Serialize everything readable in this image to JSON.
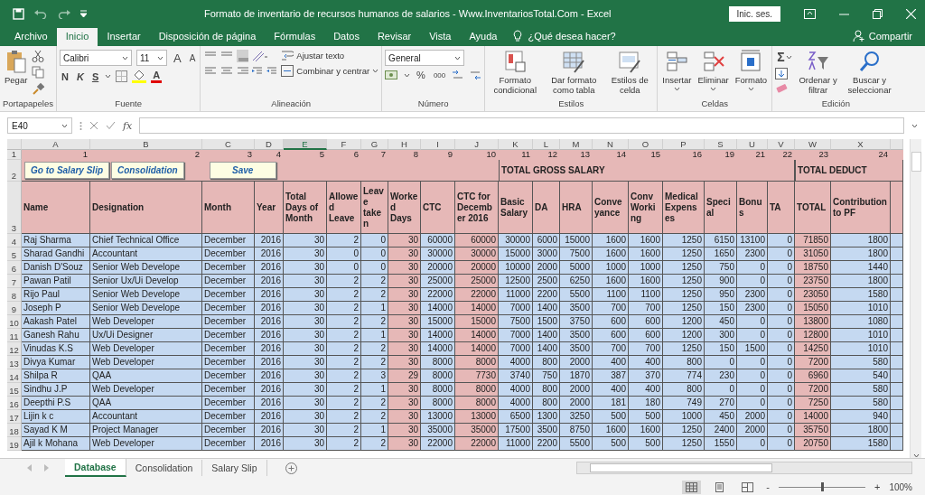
{
  "window": {
    "title": "Formato de inventario de recursos humanos de salarios - Www.InventariosTotal.Com  -  Excel",
    "sign_in": "Inic. ses."
  },
  "tabs": [
    {
      "label": "Archivo",
      "selected": false
    },
    {
      "label": "Inicio",
      "selected": true
    },
    {
      "label": "Insertar",
      "selected": false
    },
    {
      "label": "Disposición de página",
      "selected": false
    },
    {
      "label": "Fórmulas",
      "selected": false
    },
    {
      "label": "Datos",
      "selected": false
    },
    {
      "label": "Revisar",
      "selected": false
    },
    {
      "label": "Vista",
      "selected": false
    },
    {
      "label": "Ayuda",
      "selected": false
    }
  ],
  "tell_me": "¿Qué desea hacer?",
  "share": "Compartir",
  "ribbon": {
    "clipboard": {
      "label": "Portapapeles",
      "paste": "Pegar"
    },
    "font": {
      "label": "Fuente",
      "family": "Calibri",
      "size": "11",
      "grow": "A",
      "shrink": "A",
      "bold": "N",
      "italic": "K",
      "underline": "S",
      "font_color": "A"
    },
    "alignment": {
      "label": "Alineación",
      "wrap": "Ajustar texto",
      "merge": "Combinar y centrar"
    },
    "number": {
      "label": "Número",
      "format": "General",
      "percent": "%",
      "thousands": "000"
    },
    "styles": {
      "label": "Estilos",
      "buttons": [
        "Formato condicional",
        "Dar formato como tabla",
        "Estilos de celda"
      ]
    },
    "cells": {
      "label": "Celdas",
      "buttons": [
        "Insertar",
        "Eliminar",
        "Formato"
      ]
    },
    "editing": {
      "label": "Edición",
      "sum": "Σ",
      "buttons": [
        "Ordenar y filtrar",
        "Buscar y seleccionar"
      ]
    }
  },
  "formula_bar": {
    "name_box": "E40",
    "fx": "fx"
  },
  "row_numbers": [
    "1",
    "2",
    "3"
  ],
  "columns": [
    {
      "letter": "A",
      "number": "1",
      "header": "Name",
      "kind": "text",
      "highlight": false,
      "selected": false
    },
    {
      "letter": "B",
      "number": "2",
      "header": "Designation",
      "kind": "text",
      "highlight": false,
      "selected": false
    },
    {
      "letter": "C",
      "number": "3",
      "header": "Month",
      "kind": "text",
      "highlight": false,
      "selected": false
    },
    {
      "letter": "D",
      "number": "4",
      "header": "Year",
      "kind": "number",
      "highlight": false,
      "selected": false
    },
    {
      "letter": "E",
      "number": "5",
      "header": "Total Days of Month",
      "kind": "number",
      "highlight": false,
      "selected": true
    },
    {
      "letter": "F",
      "number": "6",
      "header": "Allowed Leave",
      "kind": "number",
      "highlight": false,
      "selected": false
    },
    {
      "letter": "G",
      "number": "7",
      "header": "Leave taken",
      "kind": "number",
      "highlight": false,
      "selected": false
    },
    {
      "letter": "H",
      "number": "8",
      "header": "Worked Days",
      "kind": "number",
      "highlight": true,
      "selected": false
    },
    {
      "letter": "I",
      "number": "9",
      "header": "CTC",
      "kind": "number",
      "highlight": false,
      "selected": false
    },
    {
      "letter": "J",
      "number": "10",
      "header": "CTC for December 2016",
      "kind": "number",
      "highlight": true,
      "selected": false
    },
    {
      "letter": "K",
      "number": "11",
      "header": "Basic Salary",
      "kind": "number",
      "highlight": false,
      "selected": false
    },
    {
      "letter": "L",
      "number": "12",
      "header": "DA",
      "kind": "number",
      "highlight": false,
      "selected": false
    },
    {
      "letter": "M",
      "number": "13",
      "header": "HRA",
      "kind": "number",
      "highlight": false,
      "selected": false
    },
    {
      "letter": "N",
      "number": "14",
      "header": "Conveyance",
      "kind": "number",
      "highlight": false,
      "selected": false
    },
    {
      "letter": "O",
      "number": "15",
      "header": "Conv Working",
      "kind": "number",
      "highlight": false,
      "selected": false
    },
    {
      "letter": "P",
      "number": "16",
      "header": "Medical Expenses",
      "kind": "number",
      "highlight": false,
      "selected": false
    },
    {
      "letter": "S",
      "number": "19",
      "header": "Special",
      "kind": "number",
      "highlight": false,
      "selected": false
    },
    {
      "letter": "U",
      "number": "21",
      "header": "Bonus",
      "kind": "number",
      "highlight": false,
      "selected": false
    },
    {
      "letter": "V",
      "number": "22",
      "header": "TA",
      "kind": "number",
      "highlight": false,
      "selected": false
    },
    {
      "letter": "W",
      "number": "23",
      "header": "TOTAL",
      "kind": "number",
      "highlight": true,
      "selected": false
    },
    {
      "letter": "X",
      "number": "24",
      "header": "Contribution to PF",
      "kind": "number",
      "highlight": false,
      "selected": false
    }
  ],
  "row_2": [
    {
      "kind": "button",
      "label": "Go to Salary Slip"
    },
    {
      "kind": "button",
      "label": "Consolidation"
    },
    {
      "kind": "button",
      "label": "Save"
    },
    {
      "kind": "section",
      "label": "TOTAL GROSS SALARY"
    },
    {
      "kind": "section",
      "label": "TOTAL DEDUCT"
    }
  ],
  "rows": [
    {
      "number": "4",
      "cells": [
        "Raj Sharma",
        "Chief Technical Office",
        "December",
        "2016",
        "30",
        "2",
        "0",
        "30",
        "60000",
        "60000",
        "30000",
        "6000",
        "15000",
        "1600",
        "1600",
        "1250",
        "6150",
        "13100",
        "0",
        "71850",
        "1800"
      ]
    },
    {
      "number": "5",
      "cells": [
        "Sharad Gandhi",
        "Accountant",
        "December",
        "2016",
        "30",
        "0",
        "0",
        "30",
        "30000",
        "30000",
        "15000",
        "3000",
        "7500",
        "1600",
        "1600",
        "1250",
        "1650",
        "2300",
        "0",
        "31050",
        "1800"
      ]
    },
    {
      "number": "6",
      "cells": [
        "Danish D'Souz",
        "Senior Web Develope",
        "December",
        "2016",
        "30",
        "0",
        "0",
        "30",
        "20000",
        "20000",
        "10000",
        "2000",
        "5000",
        "1000",
        "1000",
        "1250",
        "750",
        "0",
        "0",
        "18750",
        "1440"
      ]
    },
    {
      "number": "7",
      "cells": [
        "Pawan Patil",
        "Senior Ux/Ui Develop",
        "December",
        "2016",
        "30",
        "2",
        "2",
        "30",
        "25000",
        "25000",
        "12500",
        "2500",
        "6250",
        "1600",
        "1600",
        "1250",
        "900",
        "0",
        "0",
        "23750",
        "1800"
      ]
    },
    {
      "number": "8",
      "cells": [
        "Rijo Paul",
        "Senior Web Develope",
        "December",
        "2016",
        "30",
        "2",
        "2",
        "30",
        "22000",
        "22000",
        "11000",
        "2200",
        "5500",
        "1100",
        "1100",
        "1250",
        "950",
        "2300",
        "0",
        "23050",
        "1580"
      ]
    },
    {
      "number": "9",
      "cells": [
        "Joseph P",
        "Senior Web Develope",
        "December",
        "2016",
        "30",
        "2",
        "1",
        "30",
        "14000",
        "14000",
        "7000",
        "1400",
        "3500",
        "700",
        "700",
        "1250",
        "150",
        "2300",
        "0",
        "15050",
        "1010"
      ]
    },
    {
      "number": "10",
      "cells": [
        "Aakash Patel",
        "Web Developer",
        "December",
        "2016",
        "30",
        "2",
        "2",
        "30",
        "15000",
        "15000",
        "7500",
        "1500",
        "3750",
        "600",
        "600",
        "1200",
        "450",
        "0",
        "0",
        "13800",
        "1080"
      ]
    },
    {
      "number": "11",
      "cells": [
        "Ganesh Rahu",
        "Ux/Ui Designer",
        "December",
        "2016",
        "30",
        "2",
        "1",
        "30",
        "14000",
        "14000",
        "7000",
        "1400",
        "3500",
        "600",
        "600",
        "1200",
        "300",
        "0",
        "0",
        "12800",
        "1010"
      ]
    },
    {
      "number": "12",
      "cells": [
        "Vinudas K.S",
        "Web Developer",
        "December",
        "2016",
        "30",
        "2",
        "2",
        "30",
        "14000",
        "14000",
        "7000",
        "1400",
        "3500",
        "700",
        "700",
        "1250",
        "150",
        "1500",
        "0",
        "14250",
        "1010"
      ]
    },
    {
      "number": "13",
      "cells": [
        "Divya Kumar",
        "Web Developer",
        "December",
        "2016",
        "30",
        "2",
        "2",
        "30",
        "8000",
        "8000",
        "4000",
        "800",
        "2000",
        "400",
        "400",
        "800",
        "0",
        "0",
        "0",
        "7200",
        "580"
      ]
    },
    {
      "number": "14",
      "cells": [
        "Shilpa R",
        "QAA",
        "December",
        "2016",
        "30",
        "2",
        "3",
        "29",
        "8000",
        "7730",
        "3740",
        "750",
        "1870",
        "387",
        "370",
        "774",
        "230",
        "0",
        "0",
        "6960",
        "540"
      ]
    },
    {
      "number": "15",
      "cells": [
        "Sindhu J.P",
        "Web Developer",
        "December",
        "2016",
        "30",
        "2",
        "1",
        "30",
        "8000",
        "8000",
        "4000",
        "800",
        "2000",
        "400",
        "400",
        "800",
        "0",
        "0",
        "0",
        "7200",
        "580"
      ]
    },
    {
      "number": "16",
      "cells": [
        "Deepthi P.S",
        "QAA",
        "December",
        "2016",
        "30",
        "2",
        "2",
        "30",
        "8000",
        "8000",
        "4000",
        "800",
        "2000",
        "181",
        "180",
        "749",
        "270",
        "0",
        "0",
        "7250",
        "580"
      ]
    },
    {
      "number": "17",
      "cells": [
        "Lijin k c",
        "Accountant",
        "December",
        "2016",
        "30",
        "2",
        "2",
        "30",
        "13000",
        "13000",
        "6500",
        "1300",
        "3250",
        "500",
        "500",
        "1000",
        "450",
        "2000",
        "0",
        "14000",
        "940"
      ]
    },
    {
      "number": "18",
      "cells": [
        "Sayad K M",
        "Project Manager",
        "December",
        "2016",
        "30",
        "2",
        "1",
        "30",
        "35000",
        "35000",
        "17500",
        "3500",
        "8750",
        "1600",
        "1600",
        "1250",
        "2400",
        "2000",
        "0",
        "35750",
        "1800"
      ]
    },
    {
      "number": "19",
      "cells": [
        "Ajil k Mohana",
        "Web Developer",
        "December",
        "2016",
        "30",
        "2",
        "2",
        "30",
        "22000",
        "22000",
        "11000",
        "2200",
        "5500",
        "500",
        "500",
        "1250",
        "1550",
        "0",
        "0",
        "20750",
        "1580"
      ]
    }
  ],
  "sheets": [
    {
      "label": "Database",
      "selected": true
    },
    {
      "label": "Consolidation",
      "selected": false
    },
    {
      "label": "Salary Slip",
      "selected": false
    }
  ],
  "status_bar": {
    "views": [
      {
        "selected": true
      },
      {
        "selected": false
      },
      {
        "selected": false
      }
    ],
    "zoom_out": "-",
    "zoom_in": "+",
    "zoom": {
      "level": 0.5,
      "reading": "100%"
    }
  }
}
